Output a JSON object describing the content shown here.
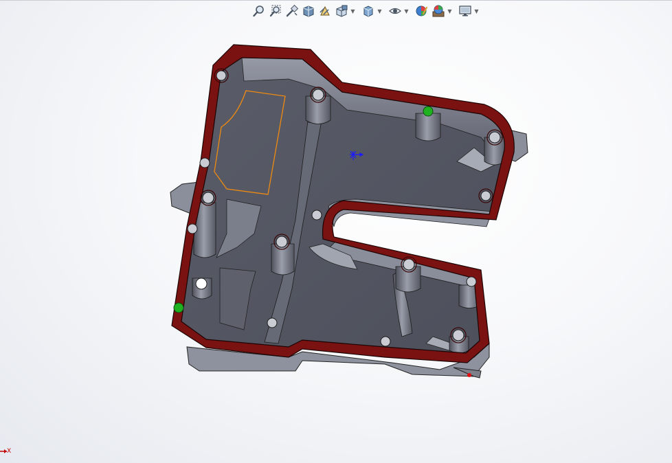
{
  "window": {
    "title": ""
  },
  "heads_up_toolbar": {
    "buttons": [
      {
        "name": "zoom-to-fit",
        "icon": "zoom-to-fit-icon"
      },
      {
        "name": "zoom-to-area",
        "icon": "zoom-to-area-icon"
      },
      {
        "name": "previous-view",
        "icon": "previous-view-icon"
      },
      {
        "name": "section-view",
        "icon": "section-view-icon"
      },
      {
        "name": "dynamic-annotation-views",
        "icon": "annotation-view-icon"
      },
      {
        "name": "view-orientation",
        "icon": "view-orientation-icon",
        "dropdown": true
      },
      {
        "name": "display-style",
        "icon": "display-style-icon",
        "dropdown": true
      },
      {
        "name": "hide-show-items",
        "icon": "eye-icon",
        "dropdown": true
      },
      {
        "name": "edit-appearance",
        "icon": "appearance-icon"
      },
      {
        "name": "apply-scene",
        "icon": "scene-icon",
        "dropdown": true
      },
      {
        "name": "view-settings",
        "icon": "monitor-icon",
        "dropdown": true
      }
    ]
  },
  "triad": {
    "x_label": "X"
  },
  "colors": {
    "face": "#5b5e6a",
    "face_light": "#8a8d9a",
    "gasket": "#7a1212",
    "selection": "#f08a10",
    "mate_hole": "#1fb11f"
  }
}
